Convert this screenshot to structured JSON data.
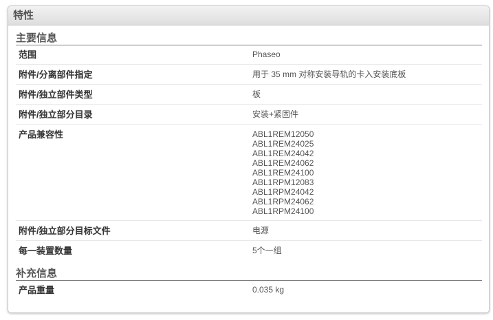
{
  "panel_title": "特性",
  "sections": [
    {
      "title": "主要信息",
      "rows": [
        {
          "label": "范围",
          "value": "Phaseo"
        },
        {
          "label": "附件/分离部件指定",
          "value": "用于 35 mm 对称安装导轨的卡入安装底板"
        },
        {
          "label": "附件/独立部件类型",
          "value": "板"
        },
        {
          "label": "附件/独立部分目录",
          "value": "安装+紧固件"
        },
        {
          "label": "产品兼容性",
          "values": [
            "ABL1REM12050",
            "ABL1REM24025",
            "ABL1REM24042",
            "ABL1REM24062",
            "ABL1REM24100",
            "ABL1RPM12083",
            "ABL1RPM24042",
            "ABL1RPM24062",
            "ABL1RPM24100"
          ]
        },
        {
          "label": "附件/独立部分目标文件",
          "value": "电源"
        },
        {
          "label": "每一装置数量",
          "value": "5个一组"
        }
      ]
    },
    {
      "title": "补充信息",
      "rows": [
        {
          "label": "产品重量",
          "value": "0.035 kg"
        }
      ]
    }
  ]
}
